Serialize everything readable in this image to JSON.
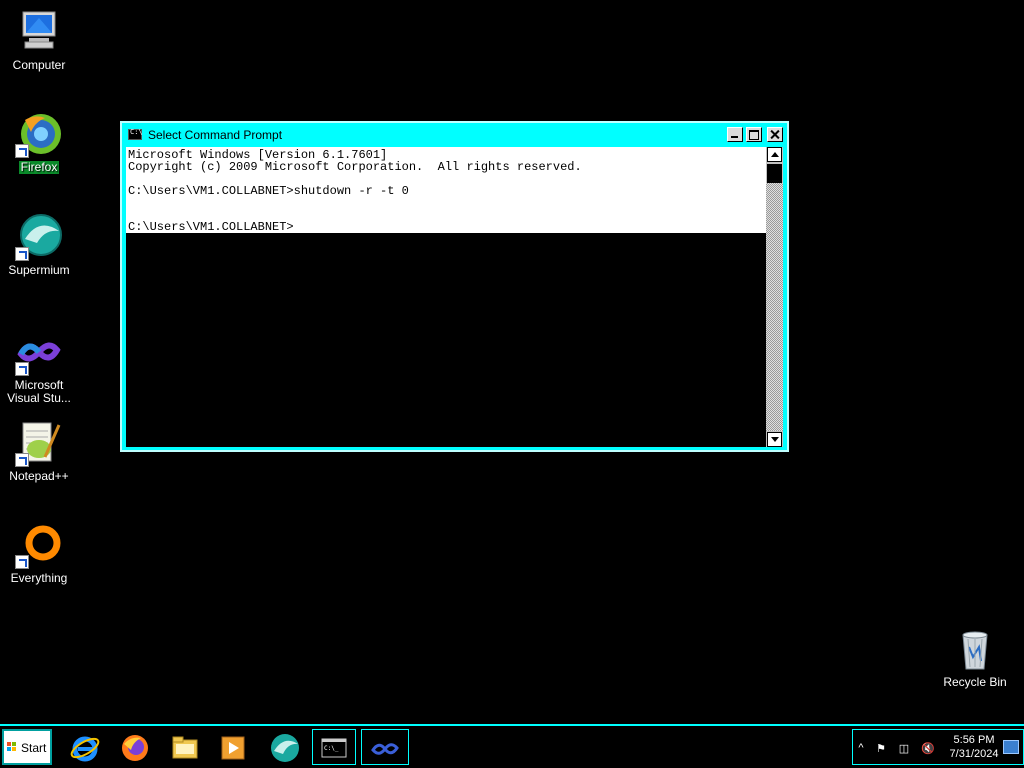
{
  "desktop": {
    "icons": [
      {
        "label": "Computer"
      },
      {
        "label": "Firefox"
      },
      {
        "label": "Supermium"
      },
      {
        "label": "Microsoft Visual Stu..."
      },
      {
        "label": "Notepad++"
      },
      {
        "label": "Everything"
      },
      {
        "label": "Recycle Bin"
      }
    ]
  },
  "window": {
    "title": "Select Command Prompt",
    "console_text": "Microsoft Windows [Version 6.1.7601]\nCopyright (c) 2009 Microsoft Corporation.  All rights reserved.\n\nC:\\Users\\VM1.COLLABNET>shutdown -r -t 0\n\n\nC:\\Users\\VM1.COLLABNET>"
  },
  "taskbar": {
    "start_label": "Start",
    "pinned": [
      "internet-explorer",
      "firefox",
      "file-explorer",
      "media-player",
      "supermium",
      "command-prompt",
      "visual-studio"
    ],
    "clock_time": "5:56 PM",
    "clock_date": "7/31/2024"
  },
  "colors": {
    "window_frame": "#00ffff",
    "desktop_bg": "#000000",
    "selection_label": "#0a8a2a"
  }
}
